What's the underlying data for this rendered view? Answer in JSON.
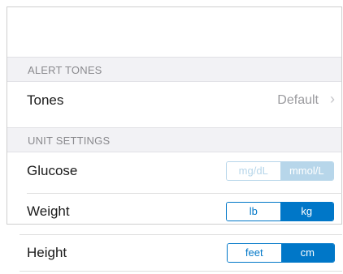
{
  "alert_tones": {
    "header": "ALERT TONES",
    "tones_label": "Tones",
    "tones_value": "Default",
    "chevron": "›"
  },
  "unit_settings": {
    "header": "UNIT SETTINGS",
    "glucose": {
      "label": "Glucose",
      "options": [
        "mg/dL",
        "mmol/L"
      ],
      "selected": "mmol/L",
      "disabled": true
    },
    "weight": {
      "label": "Weight",
      "options": [
        "lb",
        "kg"
      ],
      "selected": "kg"
    },
    "height": {
      "label": "Height",
      "options": [
        "feet",
        "cm"
      ],
      "selected": "cm"
    }
  },
  "colors": {
    "accent": "#0077c8",
    "disabled_accent": "#b7d6ea",
    "header_bg": "#f2f2f5"
  }
}
